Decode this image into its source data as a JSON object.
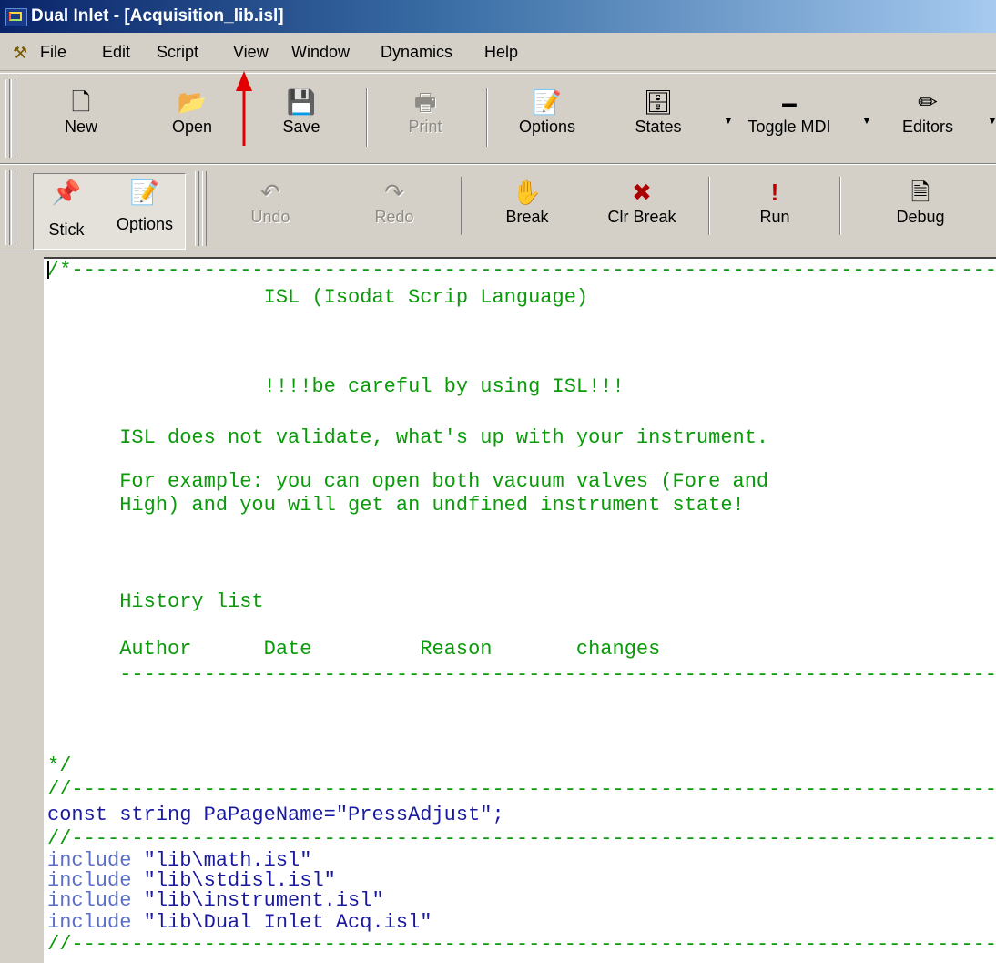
{
  "window": {
    "title": "Dual Inlet - [Acquisition_lib.isl]"
  },
  "menu": {
    "items": [
      "File",
      "Edit",
      "Script",
      "View",
      "Window",
      "Dynamics",
      "Help"
    ]
  },
  "toolbar_main": {
    "buttons": [
      {
        "label": "New",
        "icon": "new-document-icon",
        "enabled": true
      },
      {
        "label": "Open",
        "icon": "open-folder-icon",
        "enabled": true
      },
      {
        "label": "Save",
        "icon": "floppy-disk-icon",
        "enabled": true
      },
      {
        "label": "Print",
        "icon": "printer-icon",
        "enabled": false
      },
      {
        "label": "Options",
        "icon": "options-pencil-icon",
        "enabled": true
      },
      {
        "label": "States",
        "icon": "states-icon",
        "enabled": true
      },
      {
        "label": "Toggle MDI",
        "icon": "toggle-mdi-icon",
        "enabled": true
      },
      {
        "label": "Editors",
        "icon": "pencil-icon",
        "enabled": true
      }
    ]
  },
  "toolbar_script": {
    "buttons": [
      {
        "label": "Stick",
        "icon": "pushpin-icon",
        "enabled": true,
        "pressed": true
      },
      {
        "label": "Options",
        "icon": "options-pencil-icon",
        "enabled": true
      },
      {
        "label": "Undo",
        "icon": "undo-icon",
        "enabled": false
      },
      {
        "label": "Redo",
        "icon": "redo-icon",
        "enabled": false
      },
      {
        "label": "Break",
        "icon": "hand-icon",
        "enabled": true
      },
      {
        "label": "Clr Break",
        "icon": "clear-break-icon",
        "enabled": true
      },
      {
        "label": "Run",
        "icon": "exclamation-icon",
        "enabled": true
      },
      {
        "label": "Debug",
        "icon": "debug-icon",
        "enabled": true
      }
    ]
  },
  "editor": {
    "lines": [
      {
        "text": "/*-----------------------------------------------------------------------------------",
        "kind": "cmt"
      },
      {
        "text": "                  ISL (Isodat Scrip Language)",
        "kind": "cmt"
      },
      {
        "text": "",
        "kind": "cmt"
      },
      {
        "text": "",
        "kind": "cmt"
      },
      {
        "text": "                  !!!!be careful by using ISL!!!",
        "kind": "cmt"
      },
      {
        "text": "      ISL does not validate, what's up with your instrument.",
        "kind": "cmt"
      },
      {
        "text": "      For example: you can open both vacuum valves (Fore and",
        "kind": "cmt"
      },
      {
        "text": "      High) and you will get an undfined instrument state!",
        "kind": "cmt"
      },
      {
        "text": "      History list",
        "kind": "cmt"
      },
      {
        "text": "      Author      Date         Reason       changes",
        "kind": "cmt"
      },
      {
        "text": "      ---------------------------------------------------------------------------",
        "kind": "cmt"
      },
      {
        "text": "*/",
        "kind": "cmt"
      },
      {
        "text": "//-----------------------------------------------------------------------------------",
        "kind": "cmt"
      },
      {
        "text": "const string PaPageName=",
        "kind": "kw",
        "string": "\"PressAdjust\";"
      },
      {
        "text": "//-----------------------------------------------------------------------------------",
        "kind": "cmt"
      },
      {
        "text": "include ",
        "kind": "inc",
        "string": "\"lib\\math.isl\""
      },
      {
        "text": "include ",
        "kind": "inc",
        "string": "\"lib\\stdisl.isl\""
      },
      {
        "text": "include ",
        "kind": "inc",
        "string": "\"lib\\instrument.isl\""
      },
      {
        "text": "include ",
        "kind": "inc",
        "string": "\"lib\\Dual Inlet Acq.isl\""
      },
      {
        "text": "//-----------------------------------------------------------------------------------",
        "kind": "cmt"
      }
    ]
  },
  "colors": {
    "comment": "#0a9a0a",
    "keyword": "#1a1aa0",
    "include": "#5b6fc7",
    "annotation_arrow": "#e00000"
  }
}
